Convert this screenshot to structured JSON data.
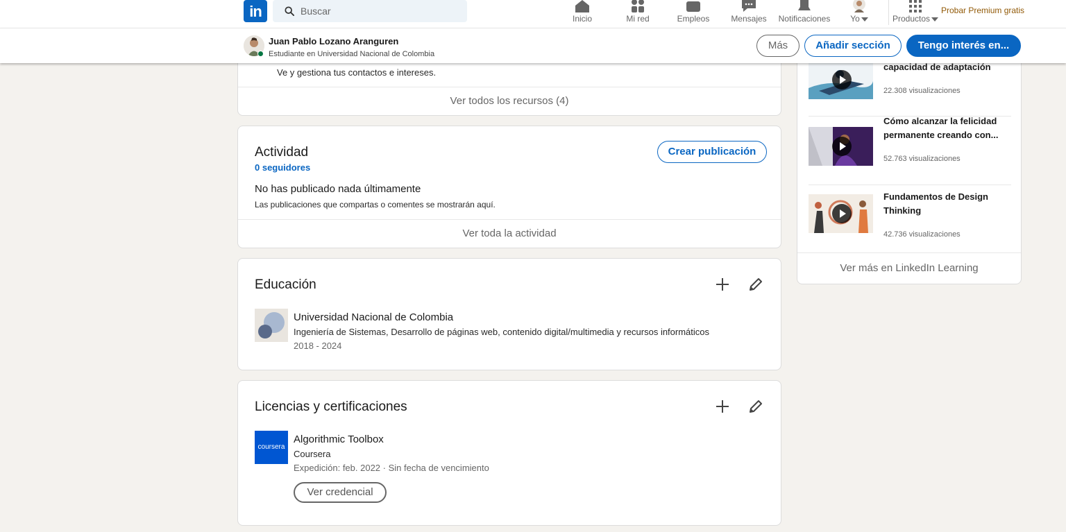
{
  "nav": {
    "logo_text": "in",
    "search_placeholder": "Buscar",
    "items": [
      {
        "label": "Inicio"
      },
      {
        "label": "Mi red"
      },
      {
        "label": "Empleos"
      },
      {
        "label": "Mensajes"
      },
      {
        "label": "Notificaciones"
      },
      {
        "label": "Yo"
      },
      {
        "label": "Productos"
      }
    ],
    "premium": "Probar Premium gratis"
  },
  "profile_bar": {
    "name": "Juan Pablo Lozano Aranguren",
    "headline": "Estudiante en Universidad Nacional de Colombia",
    "buttons": {
      "more": "Más",
      "add_section": "Añadir sección",
      "interested": "Tengo interés en..."
    }
  },
  "resources": {
    "text": "Ve y gestiona tus contactos e intereses.",
    "footer": "Ver todos los recursos (4)"
  },
  "activity": {
    "title": "Actividad",
    "followers": "0 seguidores",
    "create_button": "Crear publicación",
    "empty_title": "No has publicado nada últimamente",
    "empty_sub": "Las publicaciones que compartas o comentes se mostrarán aquí.",
    "footer": "Ver toda la actividad"
  },
  "education": {
    "title": "Educación",
    "items": [
      {
        "school": "Universidad Nacional de Colombia",
        "degree": "Ingeniería de Sistemas, Desarrollo de páginas web, contenido digital/multimedia y recursos informáticos",
        "dates": "2018 - 2024"
      }
    ]
  },
  "licenses": {
    "title": "Licencias y certificaciones",
    "items": [
      {
        "name": "Algorithmic Toolbox",
        "issuer": "Coursera",
        "issuer_logo_text": "coursera",
        "issued": "Expedición: feb. 2022 · Sin fecha de vencimiento",
        "credential_button": "Ver credencial"
      }
    ]
  },
  "learning": {
    "courses": [
      {
        "title": "Cómo desarrollar tu propia capacidad de adaptación",
        "views": "22.308 visualizaciones"
      },
      {
        "title": "Cómo alcanzar la felicidad permanente creando con...",
        "views": "52.763 visualizaciones"
      },
      {
        "title": "Fundamentos de Design Thinking",
        "views": "42.736 visualizaciones"
      }
    ],
    "footer": "Ver más en LinkedIn Learning"
  },
  "colors": {
    "brand": "#0a66c2",
    "background": "#f4f2ee",
    "premium": "#915907",
    "online": "#057642"
  }
}
